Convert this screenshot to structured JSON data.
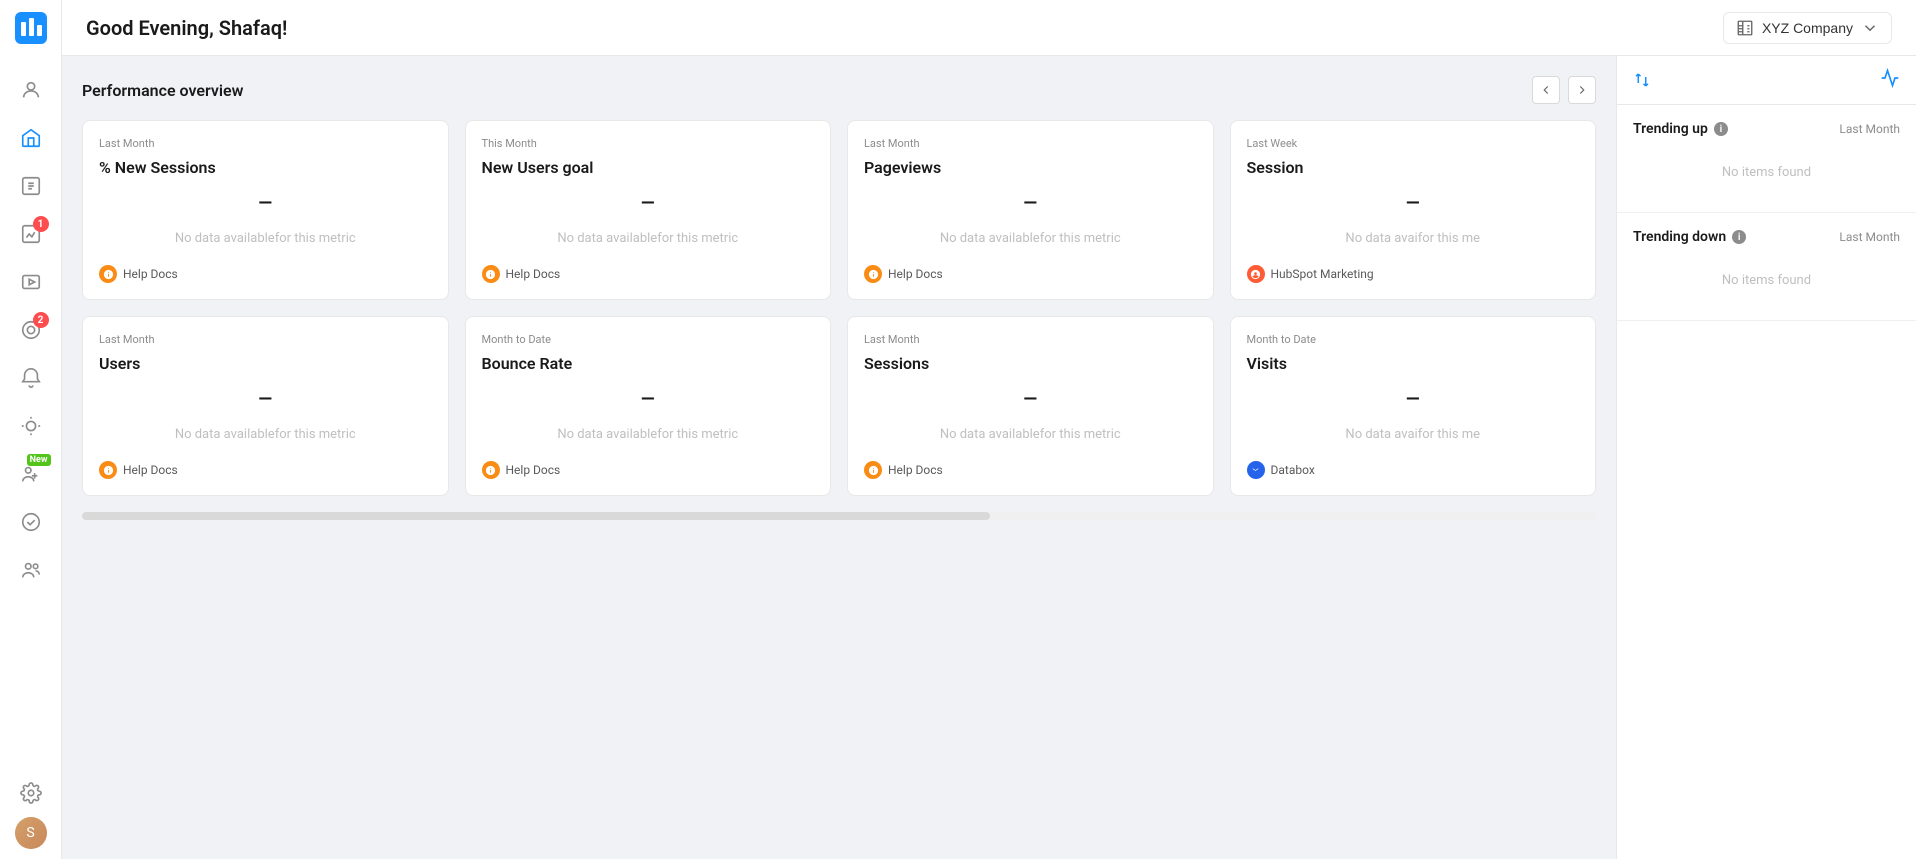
{
  "app": {
    "logo_label": "Databox Logo"
  },
  "greeting": "Good Evening, Shafaq!",
  "company": {
    "name": "XYZ Company",
    "icon": "building-icon",
    "chevron": "chevron-down-icon"
  },
  "sidebar": {
    "items": [
      {
        "id": "home",
        "icon": "home-icon",
        "active": false,
        "badge": null
      },
      {
        "id": "profile",
        "icon": "profile-icon",
        "active": false,
        "badge": null
      },
      {
        "id": "dashboard",
        "icon": "dashboard-icon",
        "active": true,
        "badge": null
      },
      {
        "id": "numbers",
        "icon": "numbers-icon",
        "active": false,
        "badge": null
      },
      {
        "id": "reports",
        "icon": "reports-icon",
        "active": false,
        "badge": "1"
      },
      {
        "id": "media",
        "icon": "media-icon",
        "active": false,
        "badge": null
      },
      {
        "id": "goals",
        "icon": "goals-icon",
        "active": false,
        "badge": "2"
      },
      {
        "id": "alerts",
        "icon": "alerts-icon",
        "active": false,
        "badge": null
      },
      {
        "id": "notifications",
        "icon": "notifications-icon",
        "active": false,
        "badge": null
      },
      {
        "id": "people-new",
        "icon": "people-new-icon",
        "active": false,
        "badge": "new"
      },
      {
        "id": "check",
        "icon": "check-icon",
        "active": false,
        "badge": null
      },
      {
        "id": "team",
        "icon": "team-icon",
        "active": false,
        "badge": null
      },
      {
        "id": "settings",
        "icon": "settings-icon",
        "active": false,
        "badge": null
      }
    ],
    "avatar": "S"
  },
  "performance_overview": {
    "title": "Performance overview",
    "nav_prev_label": "<",
    "nav_next_label": ">"
  },
  "metrics_row1": [
    {
      "period": "Last Month",
      "title": "% New Sessions",
      "dash": "—",
      "no_data_line1": "No data available",
      "no_data_line2": "for this metric",
      "footer_type": "helpdocs",
      "footer_label": "Help Docs"
    },
    {
      "period": "This Month",
      "title": "New Users goal",
      "dash": "—",
      "no_data_line1": "No data available",
      "no_data_line2": "for this metric",
      "footer_type": "helpdocs",
      "footer_label": "Help Docs"
    },
    {
      "period": "Last Month",
      "title": "Pageviews",
      "dash": "—",
      "no_data_line1": "No data available",
      "no_data_line2": "for this metric",
      "footer_type": "helpdocs",
      "footer_label": "Help Docs"
    },
    {
      "period": "Last Week",
      "title": "Session",
      "dash": "—",
      "no_data_line1": "No data avai",
      "no_data_line2": "for this me",
      "footer_type": "hubspot",
      "footer_label": "HubSpot Marketing"
    }
  ],
  "metrics_row2": [
    {
      "period": "Last Month",
      "title": "Users",
      "dash": "—",
      "no_data_line1": "No data available",
      "no_data_line2": "for this metric",
      "footer_type": "helpdocs",
      "footer_label": "Help Docs"
    },
    {
      "period": "Month to Date",
      "title": "Bounce Rate",
      "dash": "—",
      "no_data_line1": "No data available",
      "no_data_line2": "for this metric",
      "footer_type": "helpdocs",
      "footer_label": "Help Docs"
    },
    {
      "period": "Last Month",
      "title": "Sessions",
      "dash": "—",
      "no_data_line1": "No data available",
      "no_data_line2": "for this metric",
      "footer_type": "helpdocs",
      "footer_label": "Help Docs"
    },
    {
      "period": "Month to Date",
      "title": "Visits",
      "dash": "—",
      "no_data_line1": "No data avai",
      "no_data_line2": "for this me",
      "footer_type": "databox",
      "footer_label": "Databox"
    }
  ],
  "right_panel": {
    "toggle_icon": "sort-icon",
    "activity_icon": "activity-icon",
    "trending_up": {
      "title": "Trending up",
      "period": "Last Month",
      "no_items": "No items found"
    },
    "trending_down": {
      "title": "Trending down",
      "period": "Last Month",
      "no_items": "No items found"
    }
  },
  "badge_labels": {
    "new": "New",
    "1": "1",
    "2": "2"
  }
}
